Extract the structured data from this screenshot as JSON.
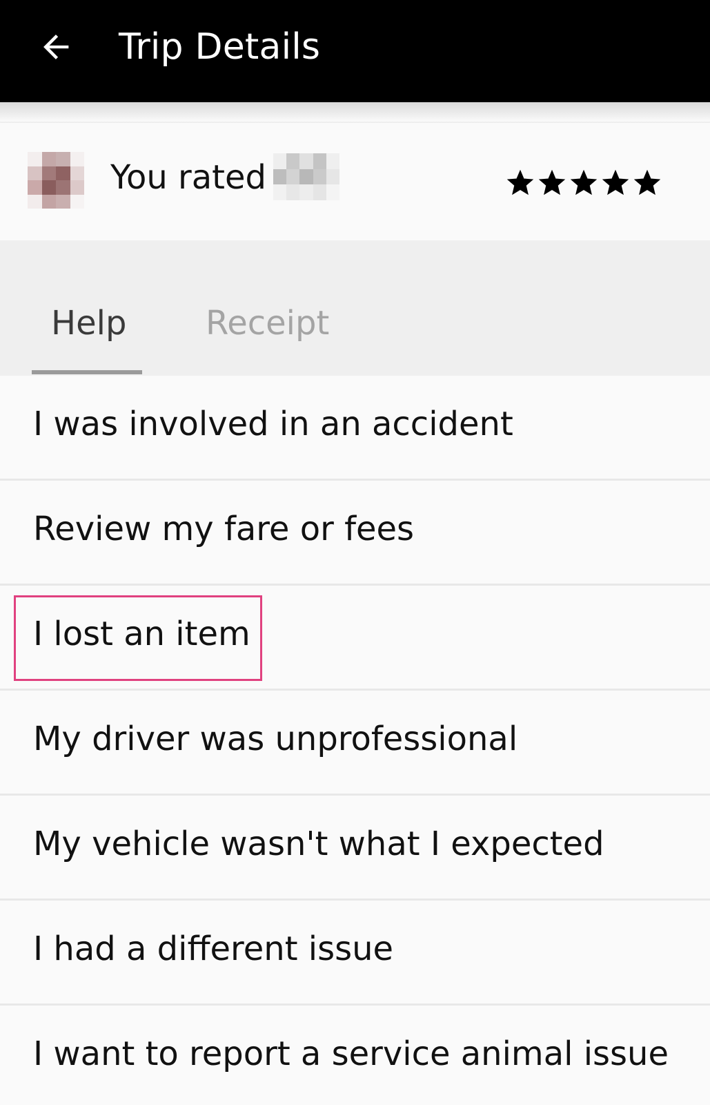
{
  "header": {
    "title": "Trip Details",
    "back_icon": "arrow-left-icon",
    "background": "#000000",
    "foreground": "#ffffff"
  },
  "rating": {
    "label": "You rated",
    "stars_filled": 5,
    "stars_total": 5,
    "star_icon": "star-icon"
  },
  "tabs": [
    {
      "label": "Help",
      "active": true
    },
    {
      "label": "Receipt",
      "active": false
    }
  ],
  "issues": [
    {
      "label": "I was involved in an accident"
    },
    {
      "label": "Review my fare or fees"
    },
    {
      "label": "I lost an item",
      "highlighted": true
    },
    {
      "label": "My driver was unprofessional"
    },
    {
      "label": "My vehicle wasn't what I expected"
    },
    {
      "label": "I had a different issue"
    },
    {
      "label": "I want to report a service animal issue"
    }
  ],
  "colors": {
    "highlight": "#e0417f",
    "tab_active": "#3a3a3a",
    "tab_inactive": "#a4a4a4"
  }
}
